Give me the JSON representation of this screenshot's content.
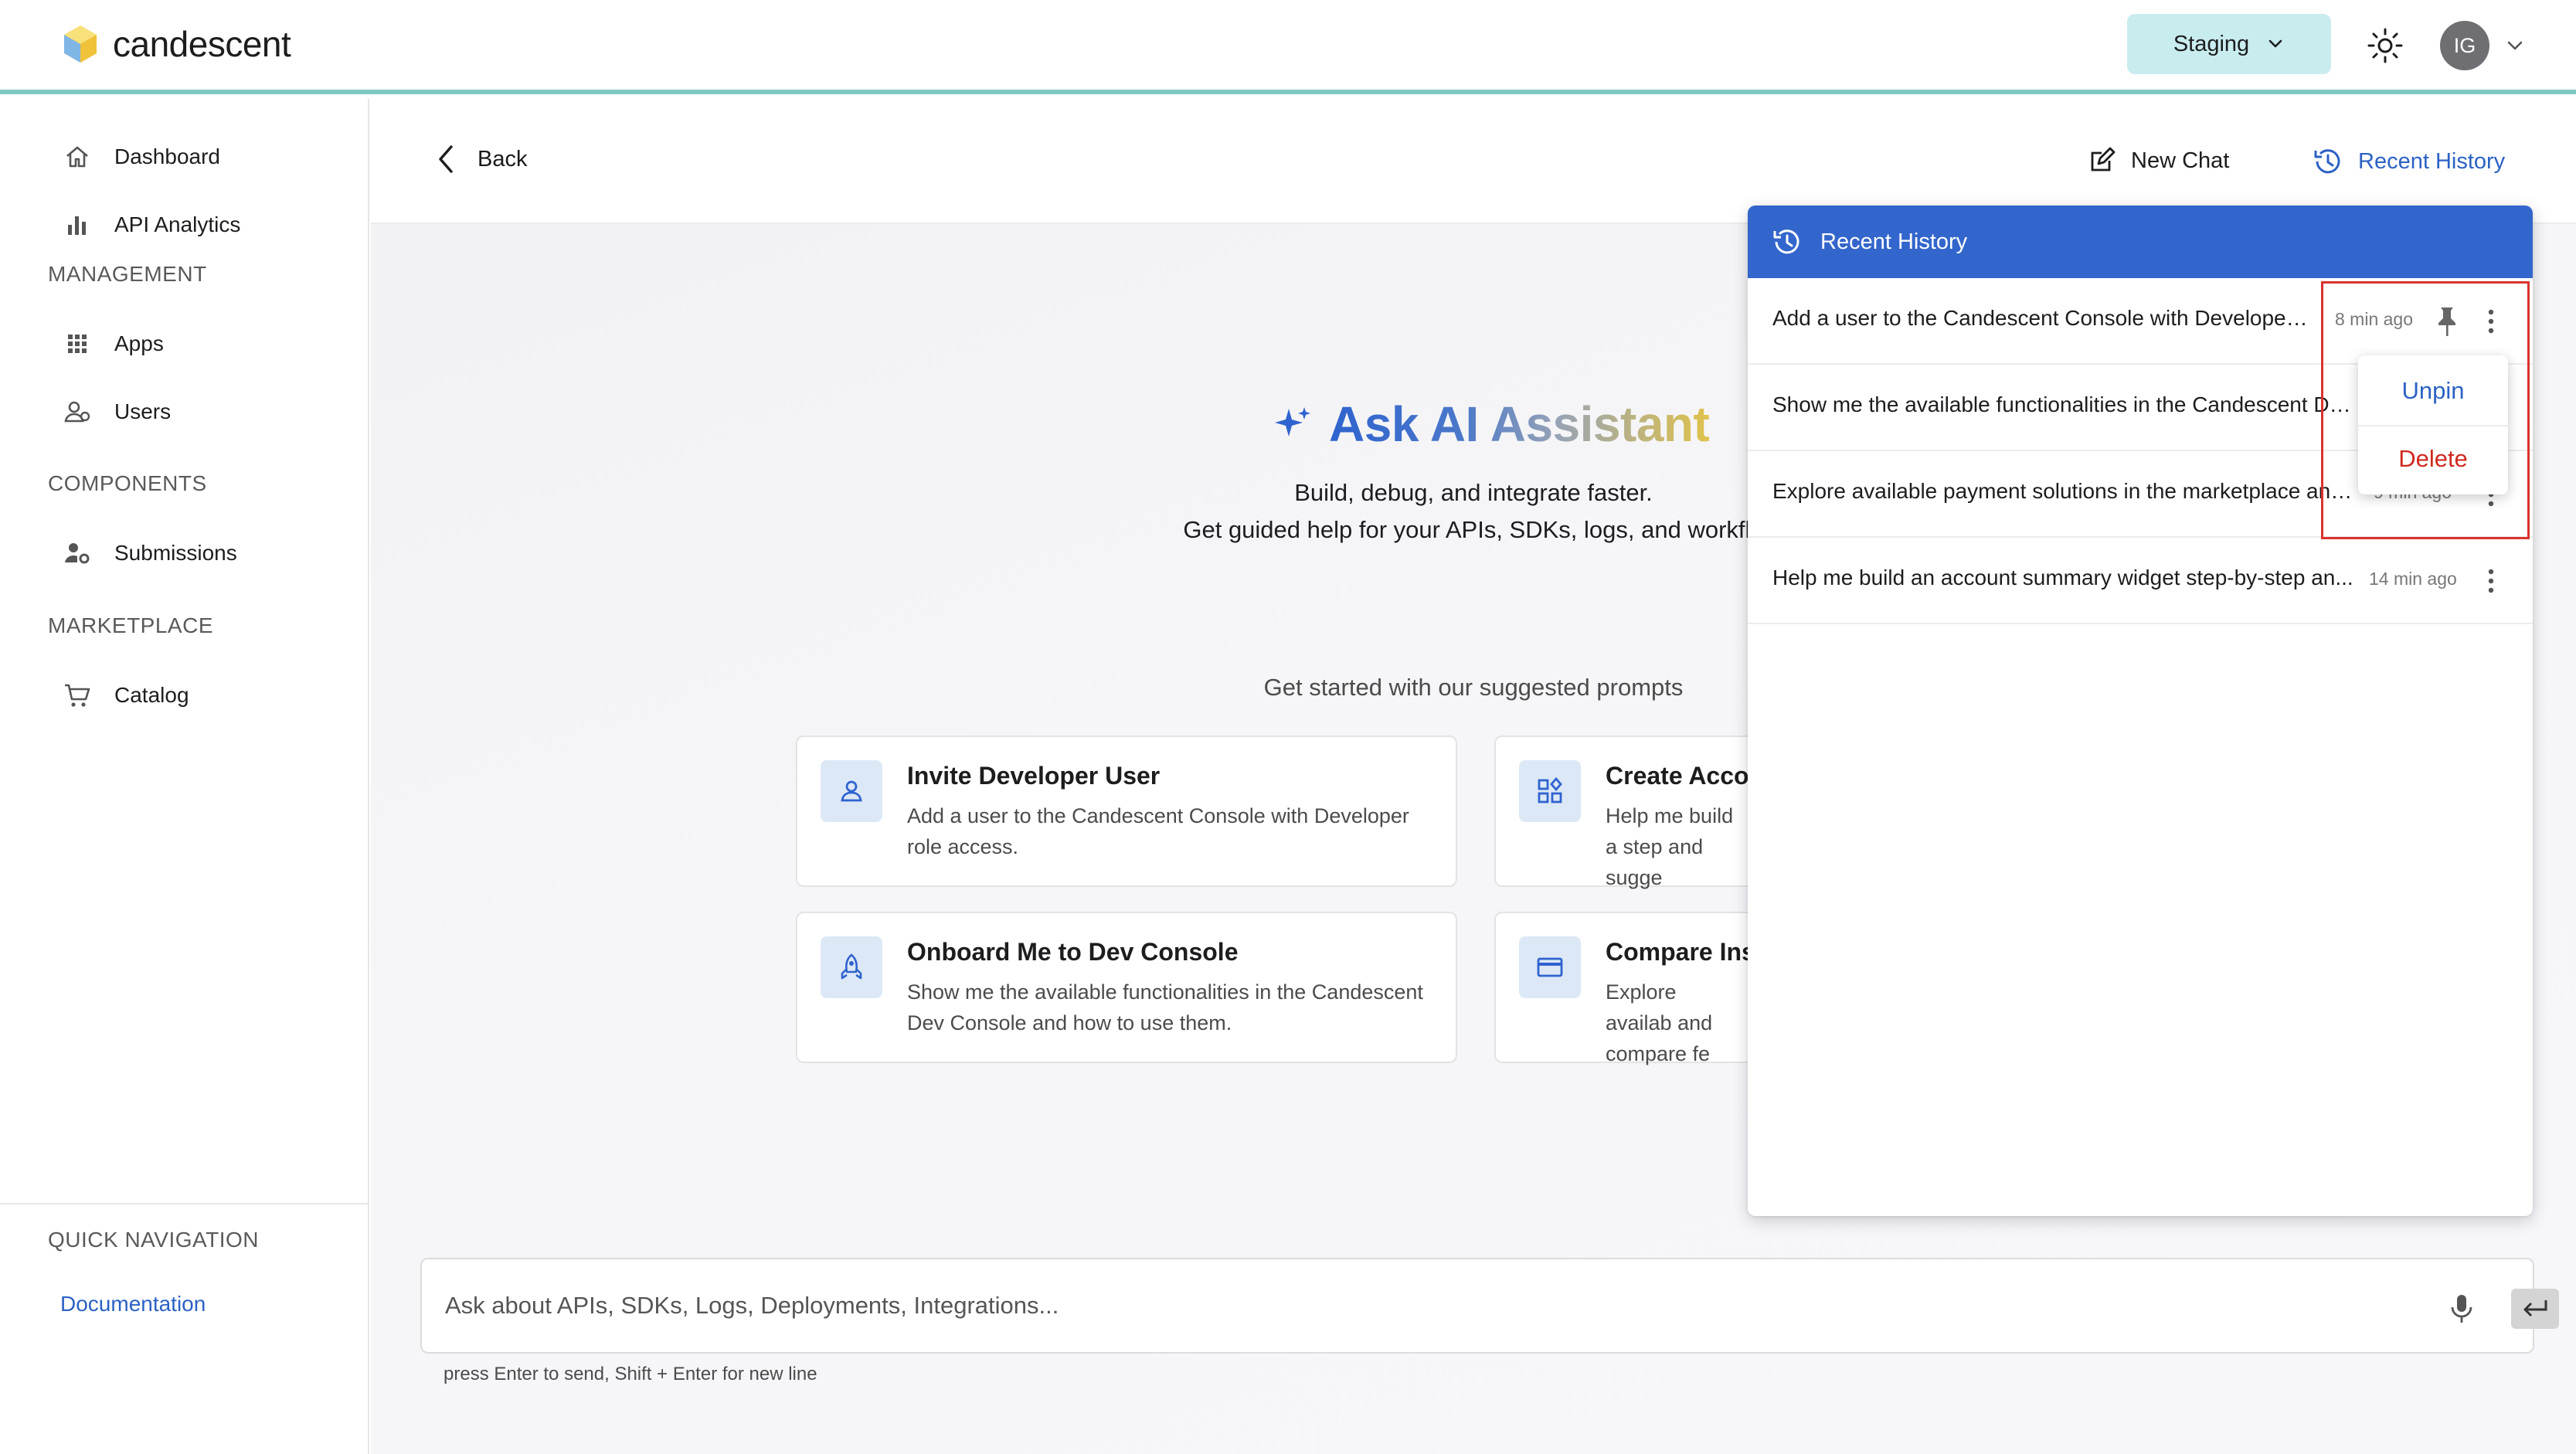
{
  "header": {
    "brand": "candescent",
    "environment": "Staging",
    "avatar_initials": "IG"
  },
  "sidebar": {
    "items_top": [
      {
        "label": "Dashboard",
        "icon": "home-icon"
      },
      {
        "label": "API Analytics",
        "icon": "bar-chart-icon"
      }
    ],
    "sections": [
      {
        "title": "MANAGEMENT",
        "items": [
          {
            "label": "Apps",
            "icon": "grid-icon"
          },
          {
            "label": "Users",
            "icon": "users-icon"
          }
        ]
      },
      {
        "title": "COMPONENTS",
        "items": [
          {
            "label": "Submissions",
            "icon": "user-settings-icon"
          }
        ]
      },
      {
        "title": "MARKETPLACE",
        "items": [
          {
            "label": "Catalog",
            "icon": "cart-icon"
          }
        ]
      }
    ],
    "quick_nav": {
      "title": "QUICK NAVIGATION",
      "link": "Documentation"
    }
  },
  "toolbar": {
    "back_label": "Back",
    "new_chat_label": "New Chat",
    "recent_history_label": "Recent History"
  },
  "hero": {
    "title": "Ask AI Assistant",
    "subtitle_line1": "Build, debug, and integrate faster.",
    "subtitle_line2": "Get guided help for your APIs, SDKs, logs, and workflo",
    "prompts_heading": "Get started with our suggested prompts"
  },
  "cards": [
    {
      "title": "Invite Developer User",
      "desc": "Add a user to the Candescent Console with Developer role access.",
      "icon": "user-icon"
    },
    {
      "title": "Create Acco",
      "desc": "Help me build a step and sugge",
      "icon": "widgets-icon"
    },
    {
      "title": "Onboard Me to Dev Console",
      "desc": "Show me the available functionalities in the Candescent Dev Console and how to use them.",
      "icon": "rocket-icon"
    },
    {
      "title": "Compare Ins",
      "desc": "Explore availab and compare fe",
      "icon": "credit-card-icon"
    }
  ],
  "chat": {
    "placeholder": "Ask about APIs, SDKs, Logs, Deployments, Integrations...",
    "value": "",
    "hint": "press Enter to send, Shift + Enter for new line"
  },
  "history": {
    "title": "Recent History",
    "items": [
      {
        "text": "Add a user to the Candescent Console with Developer ...",
        "time": "8 min ago",
        "pinned": true
      },
      {
        "text": "Show me the available functionalities in the Candescent De...",
        "time": "",
        "pinned": false
      },
      {
        "text": "Explore available payment solutions in the marketplace and...",
        "time": "9 min ago",
        "pinned": false
      },
      {
        "text": "Help me build an account summary widget step-by-step an...",
        "time": "14 min ago",
        "pinned": false
      }
    ],
    "menu": {
      "unpin": "Unpin",
      "delete": "Delete"
    }
  },
  "colors": {
    "accent_blue": "#3366cc",
    "link_blue": "#2c61c4",
    "env_bg": "#c9ecef",
    "header_border": "#7fc8c2",
    "delete_red": "#d0291f",
    "highlight_red": "#d9332e"
  }
}
